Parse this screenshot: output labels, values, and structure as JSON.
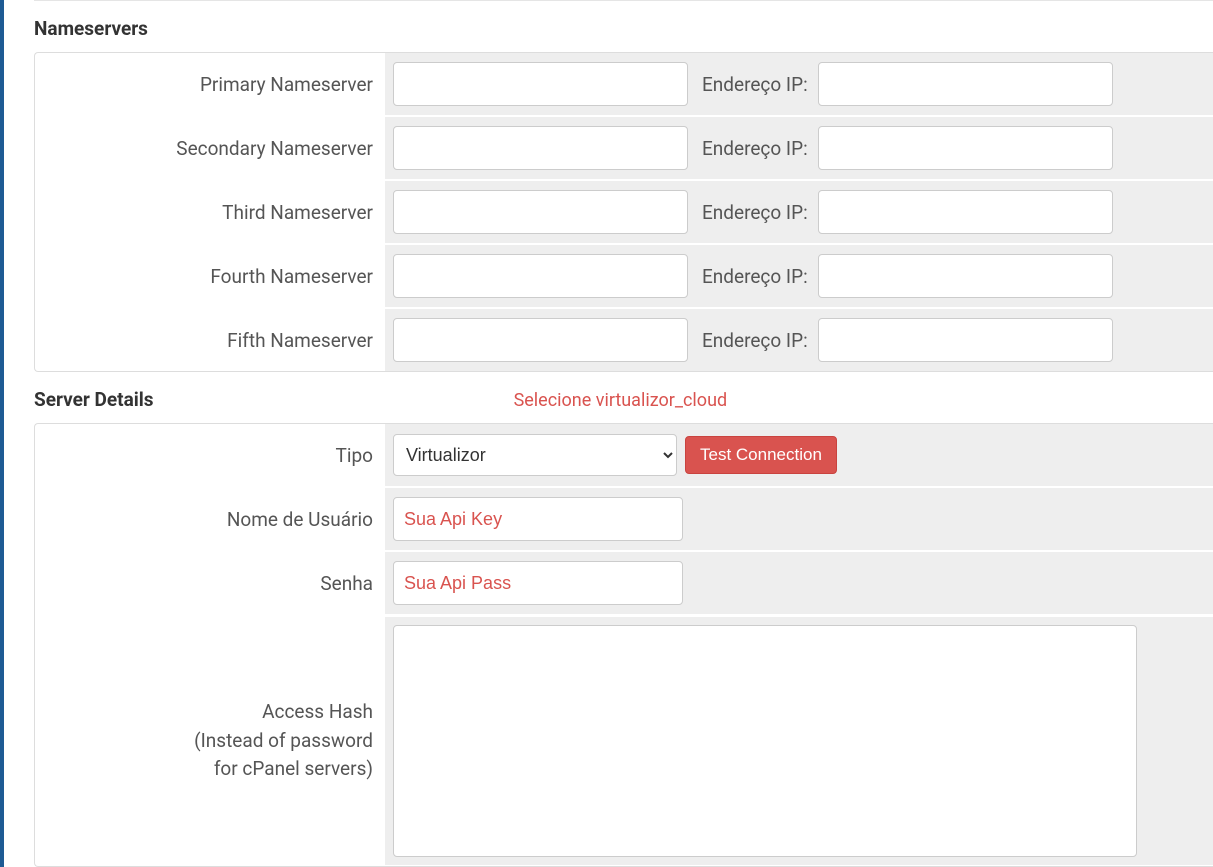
{
  "nameservers": {
    "title": "Nameservers",
    "ip_label": "Endereço IP:",
    "rows": [
      {
        "label": "Primary Nameserver",
        "ns_value": "",
        "ip_value": ""
      },
      {
        "label": "Secondary Nameserver",
        "ns_value": "",
        "ip_value": ""
      },
      {
        "label": "Third Nameserver",
        "ns_value": "",
        "ip_value": ""
      },
      {
        "label": "Fourth Nameserver",
        "ns_value": "",
        "ip_value": ""
      },
      {
        "label": "Fifth Nameserver",
        "ns_value": "",
        "ip_value": ""
      }
    ]
  },
  "server_details": {
    "title": "Server Details",
    "hint": "Selecione virtualizor_cloud",
    "type_label": "Tipo",
    "type_value": "Virtualizor",
    "test_button": "Test Connection",
    "username_label": "Nome de Usuário",
    "username_value": "Sua Api Key",
    "password_label": "Senha",
    "password_value": "Sua Api Pass",
    "access_hash_label_1": "Access Hash",
    "access_hash_label_2": "(Instead of password",
    "access_hash_label_3": "for cPanel servers)",
    "access_hash_value": ""
  }
}
